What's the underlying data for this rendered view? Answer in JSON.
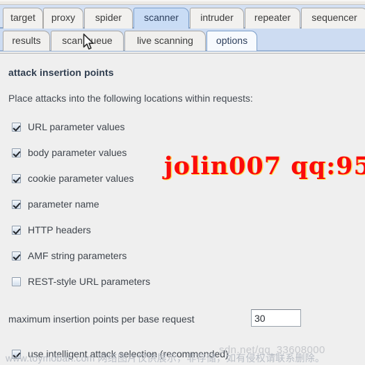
{
  "window": {
    "background_color": "#efefef",
    "accent_color": "#c9dcf5"
  },
  "tabs_primary": {
    "items": [
      {
        "label": "target",
        "selected": false
      },
      {
        "label": "proxy",
        "selected": false
      },
      {
        "label": "spider",
        "selected": false
      },
      {
        "label": "scanner",
        "selected": true
      },
      {
        "label": "intruder",
        "selected": false
      },
      {
        "label": "repeater",
        "selected": false
      },
      {
        "label": "sequencer",
        "selected": false
      }
    ]
  },
  "tabs_secondary": {
    "items": [
      {
        "label": "results",
        "selected": false
      },
      {
        "label": "scan queue",
        "selected": false
      },
      {
        "label": "live scanning",
        "selected": false
      },
      {
        "label": "options",
        "selected": true
      }
    ]
  },
  "panel": {
    "title": "attack insertion points",
    "description": "Place attacks into the following locations within requests:",
    "checkboxes": [
      {
        "label": "URL parameter values",
        "checked": true
      },
      {
        "label": "body parameter values",
        "checked": true
      },
      {
        "label": "cookie parameter values",
        "checked": true
      },
      {
        "label": "parameter name",
        "checked": true
      },
      {
        "label": "HTTP headers",
        "checked": true
      },
      {
        "label": "AMF string parameters",
        "checked": true
      },
      {
        "label": "REST-style URL parameters",
        "checked": false
      }
    ],
    "max_insertion": {
      "label": "maximum insertion points per base request",
      "value": "30",
      "placeholder": ""
    },
    "intelligent_selection": {
      "label": "use intelligent attack selection (recommended)",
      "checked": true
    }
  },
  "overlays": {
    "red_watermark": "jolin007 qq:95",
    "csdn_watermark": "sdn.net/qq_33608000",
    "toymoban_watermark": "www.toymoban.com 网络图片仅供展示，非存储，如有侵权请联系删除。"
  }
}
